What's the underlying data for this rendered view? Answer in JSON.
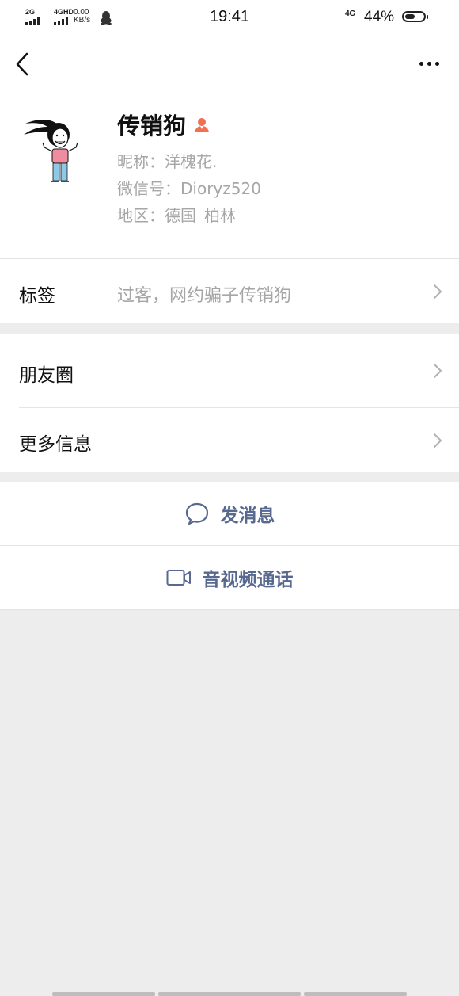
{
  "status_bar": {
    "network1": "2G",
    "network2": "4GHD",
    "speed_value": "0.00",
    "speed_unit": "KB/s",
    "time": "19:41",
    "network3": "4G",
    "battery": "44%",
    "battery_level": 0.44
  },
  "profile": {
    "name": "传销狗",
    "nickname": "昵称：洋槐花.",
    "wechat_id": "微信号：Dioryz520",
    "region_prefix": "地区：德国",
    "region_city": "柏林"
  },
  "rows": {
    "tags_label": "标签",
    "tags_value": "过客，网约骗子传销狗",
    "moments_label": "朋友圈",
    "more_info_label": "更多信息"
  },
  "actions": {
    "send_message": "发消息",
    "av_call": "音视频通话"
  },
  "colors": {
    "accent": "#57698f",
    "gender_female": "#f07052",
    "background": "#ededed"
  }
}
